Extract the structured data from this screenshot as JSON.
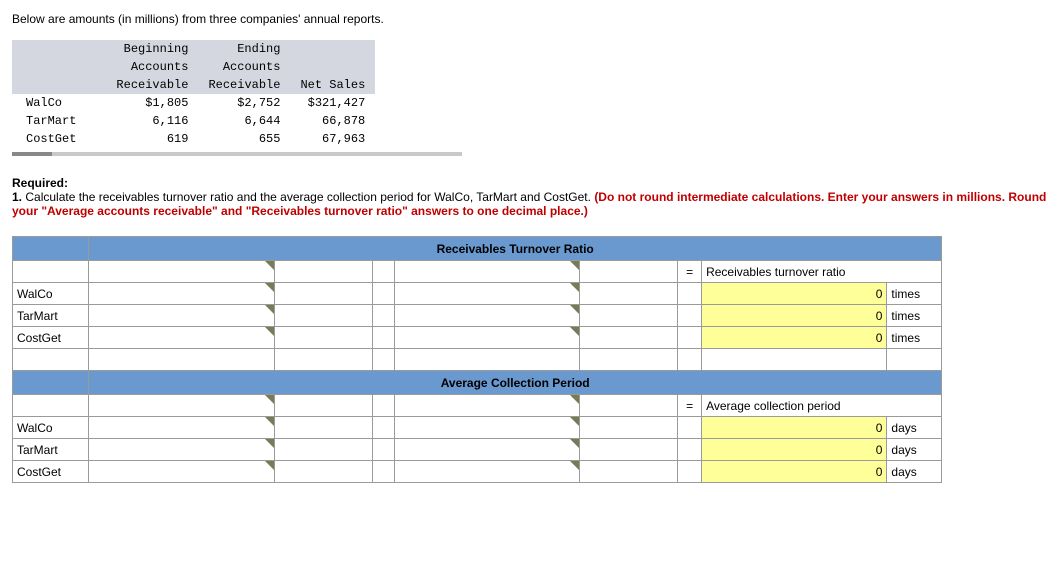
{
  "intro": "Below are amounts (in millions) from three companies' annual reports.",
  "dataTable": {
    "headers": {
      "c1": "",
      "c2a": "Beginning",
      "c2b": "Accounts",
      "c2c": "Receivable",
      "c3a": "Ending",
      "c3b": "Accounts",
      "c3c": "Receivable",
      "c4": "Net Sales"
    },
    "rows": [
      {
        "name": "WalCo",
        "begin": "$1,805",
        "end": "$2,752",
        "sales": "$321,427"
      },
      {
        "name": "TarMart",
        "begin": "6,116",
        "end": "6,644",
        "sales": "66,878"
      },
      {
        "name": "CostGet",
        "begin": "619",
        "end": "655",
        "sales": "67,963"
      }
    ]
  },
  "required": {
    "label": "Required:",
    "num": "1.",
    "text": " Calculate the receivables turnover ratio and the average collection period for WalCo, TarMart and CostGet. ",
    "red1": "(Do not round intermediate calculations. Enter your answers in millions. Round your \"Average accounts receivable\" and \"Receivables turnover ratio\" answers to one decimal place.)"
  },
  "section1": {
    "title": "Receivables Turnover Ratio",
    "eq": "=",
    "resultLabel": "Receivables turnover ratio",
    "rows": [
      {
        "name": "WalCo",
        "val": "0",
        "unit": "times"
      },
      {
        "name": "TarMart",
        "val": "0",
        "unit": "times"
      },
      {
        "name": "CostGet",
        "val": "0",
        "unit": "times"
      }
    ]
  },
  "section2": {
    "title": "Average Collection Period",
    "eq": "=",
    "resultLabel": "Average collection period",
    "rows": [
      {
        "name": "WalCo",
        "val": "0",
        "unit": "days"
      },
      {
        "name": "TarMart",
        "val": "0",
        "unit": "days"
      },
      {
        "name": "CostGet",
        "val": "0",
        "unit": "days"
      }
    ]
  }
}
